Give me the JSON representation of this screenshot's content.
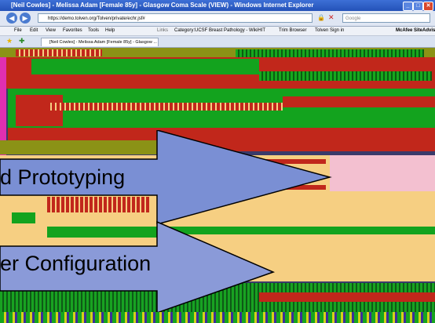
{
  "window": {
    "title": "[Neil Cowles] - Melissa Adam [Female 85y] - Glasgow Coma Scale (VIEW) - Windows Internet Explorer",
    "minimize": "_",
    "maximize": "□",
    "close": "✕"
  },
  "addressbar": {
    "url": "https://demo.tolven.org/Tolven/private/echr.jsf#",
    "search_placeholder": "Google"
  },
  "menu": {
    "items": [
      "File",
      "Edit",
      "View",
      "Favorites",
      "Tools",
      "Help"
    ],
    "links_label": "Links",
    "links": [
      "Category:UCSF Breast Pathology - WikiHIT",
      "Trim Browser",
      "Tolven Sign in"
    ],
    "mcafee": "McAfee SiteAdvisor"
  },
  "tabs": {
    "active": "[Neil Cowles] - Melissa Adam [Female 85y] - Glasgow ..."
  },
  "overlay": {
    "banner1": "d Prototyping",
    "banner2": "er Configuration"
  },
  "colors": {
    "titlebar": "#2452b8",
    "arrow_fill": "#7a8fd4",
    "banner_fill": "#8a9ad8",
    "red": "#c1271b",
    "green": "#13a31e",
    "peach": "#f6cf82"
  }
}
